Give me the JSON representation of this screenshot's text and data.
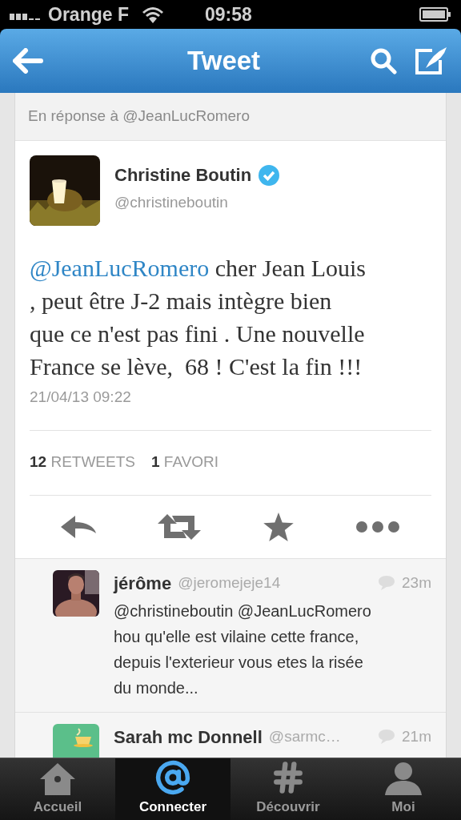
{
  "status_bar": {
    "carrier": "Orange F",
    "time": "09:58"
  },
  "nav": {
    "title": "Tweet"
  },
  "reply_to": "En réponse à @JeanLucRomero",
  "tweet": {
    "name": "Christine Boutin",
    "verified": true,
    "handle": "@christineboutin",
    "mention": "@JeanLucRomero",
    "lines": [
      " cher Jean Louis",
      ", peut être J-2 mais intègre bien",
      "que ce n'est pas fini . Une nouvelle",
      "France se lève,  68 ! C'est la fin !!!"
    ],
    "date": "21/04/13 09:22"
  },
  "stats": [
    {
      "count": "12",
      "label": "RETWEETS"
    },
    {
      "count": "1",
      "label": "FAVORI"
    }
  ],
  "actions": [
    {
      "kind": "reply"
    },
    {
      "kind": "retweet"
    },
    {
      "kind": "favorite"
    },
    {
      "kind": "more"
    }
  ],
  "replies": [
    {
      "name": "jérôme",
      "handle": "@jeromejeje14",
      "time": "23m",
      "lines": [
        "@christineboutin @JeanLucRomero",
        "hou qu'elle est vilaine cette france,",
        "depuis l'exterieur vous etes la risée",
        "du monde..."
      ]
    },
    {
      "name": "Sarah mc Donnell",
      "handle": "@sarmc…",
      "time": "21m"
    }
  ],
  "tabs": [
    {
      "label": "Accueil",
      "kind": "home",
      "selected": false
    },
    {
      "label": "Connecter",
      "kind": "at",
      "selected": true
    },
    {
      "label": "Découvrir",
      "kind": "hash",
      "selected": false
    },
    {
      "label": "Moi",
      "kind": "me",
      "selected": false
    }
  ]
}
